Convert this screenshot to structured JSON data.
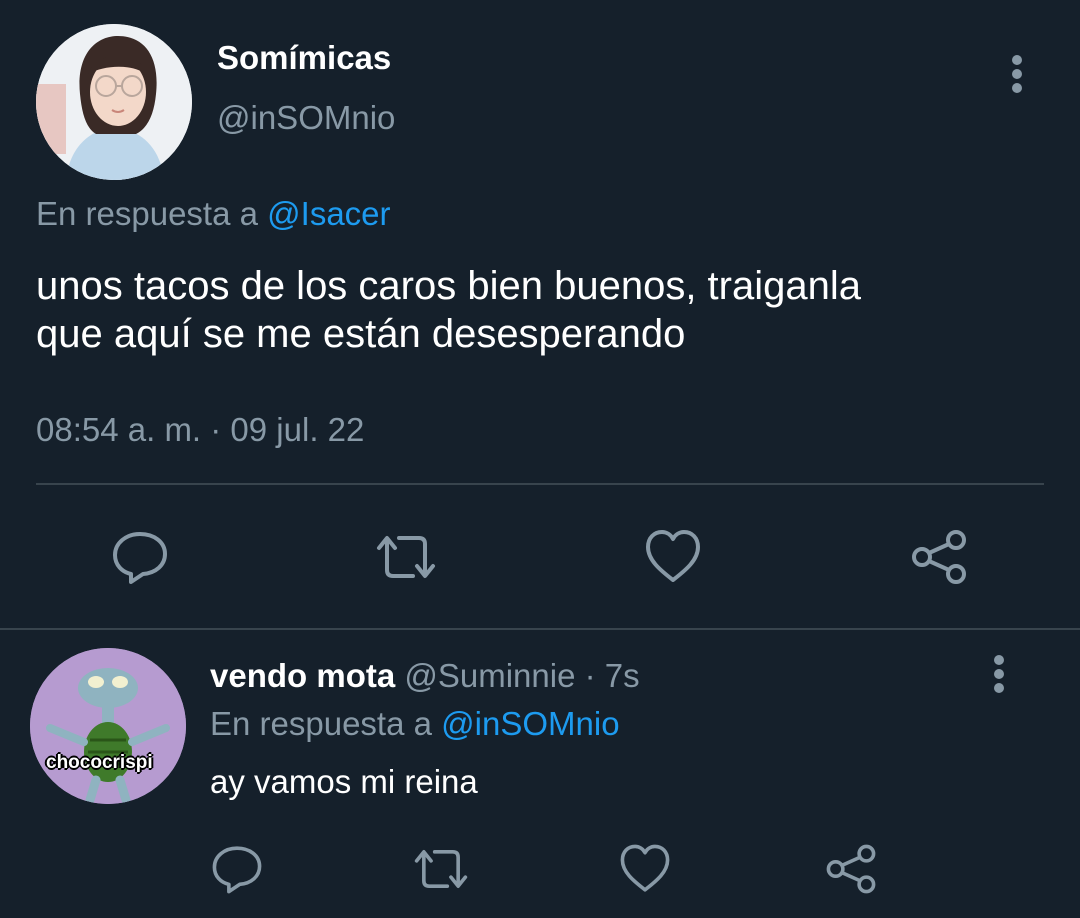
{
  "main_tweet": {
    "display_name": "Somímicas",
    "handle": "@inSOMnio",
    "reply_prefix": "En respuesta a",
    "reply_to": "@Isacer",
    "text_line1": "unos tacos de los caros bien buenos, traiganla",
    "text_line2": "que aquí se me están desesperando",
    "timestamp": "08:54 a. m. · 09 jul. 22"
  },
  "reply_tweet": {
    "display_name": "vendo mota",
    "handle_time": "@Suminnie · 7s",
    "reply_prefix": "En respuesta a",
    "reply_to": "@inSOMnio",
    "text": "ay vamos mi reina",
    "avatar_caption": "chococrispi"
  },
  "icons": {
    "reply": "reply-icon",
    "retweet": "retweet-icon",
    "like": "heart-icon",
    "share": "share-icon",
    "more": "more-vertical-icon"
  },
  "colors": {
    "background": "#15202b",
    "text": "#ffffff",
    "secondary": "#8899a6",
    "link": "#1d9bf0",
    "divider": "#38444d"
  }
}
